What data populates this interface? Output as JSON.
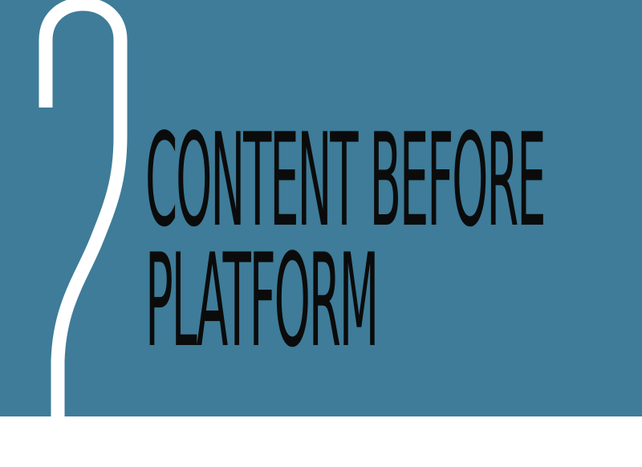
{
  "colors": {
    "panel": "#3e7c99",
    "numeral": "#ffffff",
    "heading": "#0b0b0b",
    "page": "#ffffff"
  },
  "chapter": {
    "number": "2",
    "title_lines": [
      "CONTENT BEFORE",
      "PLATFORM"
    ]
  }
}
